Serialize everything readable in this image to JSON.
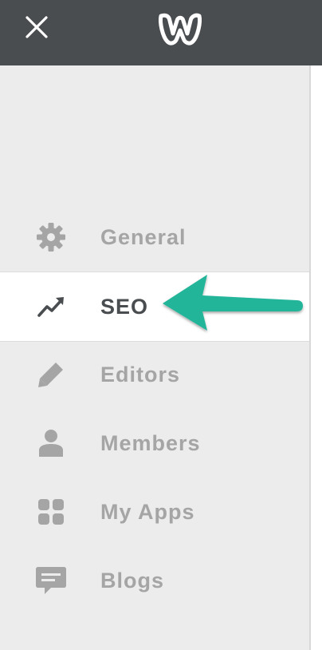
{
  "header": {
    "close_icon": "close-icon",
    "logo_icon": "weebly-logo-icon",
    "background_color": "#4a4d50"
  },
  "sidebar": {
    "items": [
      {
        "label": "General",
        "icon": "gear-icon",
        "active": false
      },
      {
        "label": "SEO",
        "icon": "trending-up-icon",
        "active": true
      },
      {
        "label": "Editors",
        "icon": "pencil-icon",
        "active": false
      },
      {
        "label": "Members",
        "icon": "person-icon",
        "active": false
      },
      {
        "label": "My Apps",
        "icon": "apps-grid-icon",
        "active": false
      },
      {
        "label": "Blogs",
        "icon": "comment-icon",
        "active": false
      }
    ],
    "background_color": "#ececec",
    "active_background_color": "#ffffff",
    "label_color": "#a5a5a5",
    "active_label_color": "#4a4d50"
  },
  "annotation": {
    "arrow_color": "#21b59a",
    "target": "SEO"
  }
}
